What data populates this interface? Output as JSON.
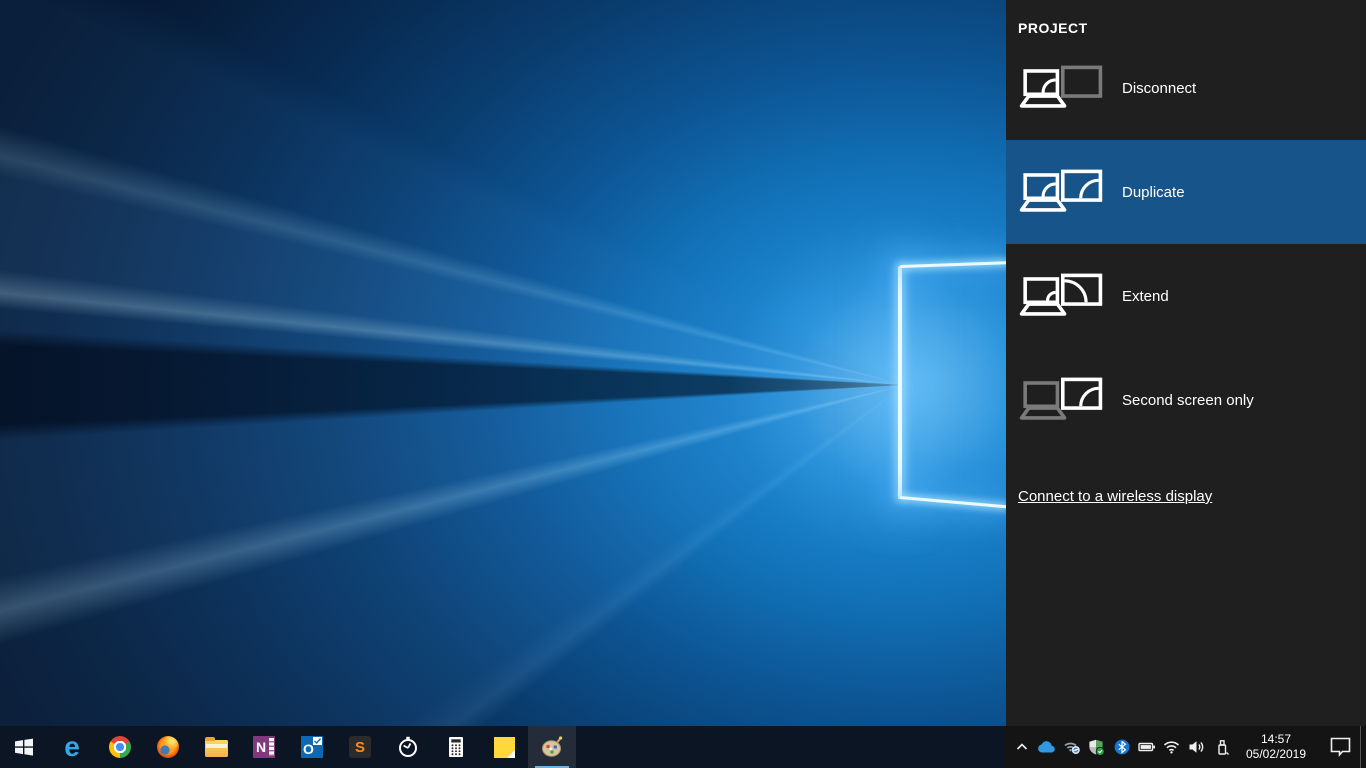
{
  "project_panel": {
    "title": "PROJECT",
    "options": [
      {
        "label": "Disconnect",
        "selected": false
      },
      {
        "label": "Duplicate",
        "selected": true
      },
      {
        "label": "Extend",
        "selected": false
      },
      {
        "label": "Second screen only",
        "selected": false
      }
    ],
    "selected_option": "Duplicate",
    "wireless_link": "Connect to a wireless display",
    "colors": {
      "panel_bg": "#1f1f1f",
      "selected_bg": "#17548a",
      "text": "#ffffff"
    }
  },
  "taskbar": {
    "apps": [
      "start-windows-logo",
      "edge-browser",
      "chrome-browser",
      "firefox-browser",
      "file-explorer",
      "onenote",
      "outlook",
      "sublime-text",
      "alarms-clock",
      "calculator",
      "sticky-notes",
      "paint-palette"
    ],
    "active_app": "paint-palette",
    "glyphs": {
      "edge": "e",
      "onenote": "N",
      "outlook": "O",
      "sublime": "S"
    },
    "tray_icons": [
      "hidden-icons-chevron",
      "onedrive-cloud",
      "network-sync",
      "windows-security-shield",
      "bluetooth",
      "battery",
      "wifi",
      "volume",
      "usb-device"
    ],
    "clock": {
      "time": "14:57",
      "date": "05/02/2019"
    },
    "colors": {
      "bg": "#0c1524",
      "active_underline": "#6cb3e6",
      "onedrive_blue": "#2f9ae3"
    }
  },
  "wallpaper": {
    "base_navy": "#071d3a",
    "glow_blue": "#3aa4ea"
  }
}
